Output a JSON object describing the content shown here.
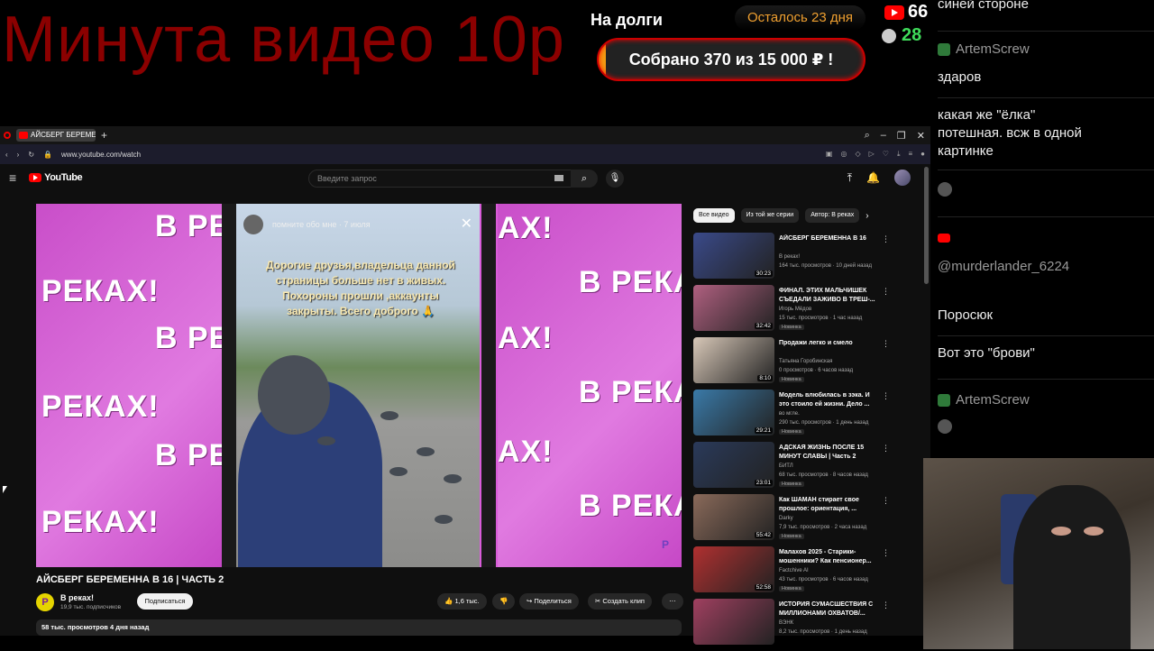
{
  "overlay": {
    "ticker_text": "Минута видео 10р",
    "debt_title": "На долги",
    "days_left": "Осталось 23 дня",
    "collected_text": "Собрано 370  из 15 000 ₽ !",
    "youtube_viewers": "66",
    "twitch_viewers": "28"
  },
  "browser": {
    "tab_title": "АЙСБЕРГ БЕРЕМЕНН",
    "url": "www.youtube.com/watch"
  },
  "youtube": {
    "logo_text": "YouTube",
    "search_placeholder": "Введите запрос"
  },
  "video": {
    "promo_word_1": "В РЕ",
    "promo_word_2": "РЕКАХ!",
    "promo_word_3": "АХ!",
    "promo_word_4": "В РЕКА",
    "story_name": "помните обо мне · 7 июля",
    "story_caption": "Дорогие друзья,владельца данной страницы больше нет в живых. Похороны прошли ,аккаунты закрыты. Всего доброго 🙏",
    "title": "АЙСБЕРГ БЕРЕМЕННА В 16 | ЧАСТЬ 2",
    "channel_name": "В реках!",
    "channel_subs": "19,9 тыс. подписчиков",
    "subscribe_label": "Подписаться",
    "likes": "1,6 тыс.",
    "share_label": "Поделиться",
    "clip_label": "Создать клип",
    "views_date": "58 тыс. просмотров  4 дня назад"
  },
  "chips": [
    "Все видео",
    "Из той же серии",
    "Автор: В реках"
  ],
  "recommendations": [
    {
      "title": "АЙСБЕРГ БЕРЕМЕННА В 16",
      "channel": "В реках!",
      "meta": "164 тыс. просмотров · 10 дней назад",
      "duration": "30:23",
      "badge": "",
      "color": "#3a4a8a"
    },
    {
      "title": "ФИНАЛ. ЭТИХ МАЛЬЧИШЕК СЪЕДАЛИ ЗАЖИВО В ТРЕШ-...",
      "channel": "Игорь Мёдов",
      "meta": "15 тыс. просмотров · 1 час назад",
      "duration": "32:42",
      "badge": "Новинка",
      "color": "#b06080"
    },
    {
      "title": "Продажи легко и смело",
      "channel": "Татьяна Горобинская",
      "meta": "0 просмотров · 6 часов назад",
      "duration": "8:10",
      "badge": "Новинка",
      "color": "#d8c8b8"
    },
    {
      "title": "Модель влюбилась в зэка. И это стоило ей жизни. Дело ...",
      "channel": "во мгле.",
      "meta": "290 тыс. просмотров · 1 день назад",
      "duration": "29:21",
      "badge": "Новинка",
      "color": "#3a7aa8"
    },
    {
      "title": "АДСКАЯ ЖИЗНЬ ПОСЛЕ 15 МИНУТ СЛАВЫ | Часть 2",
      "channel": "БИТЛ",
      "meta": "68 тыс. просмотров · 8 часов назад",
      "duration": "23:01",
      "badge": "Новинка",
      "color": "#2a3a5a"
    },
    {
      "title": "Как ШАМАН стирает свое прошлое: ориентация, ...",
      "channel": "Darky",
      "meta": "7,9 тыс. просмотров · 2 часа назад",
      "duration": "55:42",
      "badge": "Новинка",
      "color": "#8a6a5a"
    },
    {
      "title": "Малахов 2025 - Старики-мошенники? Как пенсионер...",
      "channel": "Factchive AI",
      "meta": "43 тыс. просмотров · 6 часов назад",
      "duration": "52:58",
      "badge": "Новинка",
      "color": "#b03030"
    },
    {
      "title": "ИСТОРИЯ СУМАСШЕСТВИЯ С МИЛЛИОНАМИ ОХВАТОВ/...",
      "channel": "ВЭНК",
      "meta": "8,2 тыс. просмотров · 1 день назад",
      "duration": "",
      "badge": "",
      "color": "#a04060"
    }
  ],
  "chat": {
    "m0": "синей стороне",
    "u1": "ArtemScrew",
    "m1": "здаров",
    "m2": "какая же \"ёлка\" потешная. всж в одной картинке",
    "u3": "@murderlander_6224",
    "m3": "Поросюк",
    "m4": "Вот это \"брови\"",
    "u5": "ArtemScrew"
  }
}
